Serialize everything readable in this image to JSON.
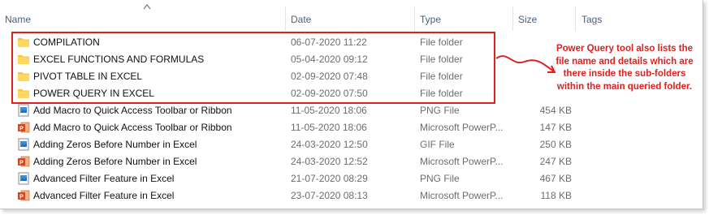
{
  "columns": {
    "name": "Name",
    "date": "Date",
    "type": "Type",
    "size": "Size",
    "tags": "Tags"
  },
  "folders": [
    {
      "name": "COMPILATION",
      "date": "06-07-2020 11:22",
      "type": "File folder",
      "icon": "folder-icon"
    },
    {
      "name": "EXCEL FUNCTIONS AND FORMULAS",
      "date": "05-04-2020 09:12",
      "type": "File folder",
      "icon": "folder-icon"
    },
    {
      "name": "PIVOT TABLE IN EXCEL",
      "date": "02-09-2020 07:48",
      "type": "File folder",
      "icon": "folder-icon"
    },
    {
      "name": "POWER QUERY IN EXCEL",
      "date": "02-09-2020 07:50",
      "type": "File folder",
      "icon": "folder-icon"
    }
  ],
  "files": [
    {
      "name": "Add Macro to Quick Access Toolbar or Ribbon",
      "date": "11-05-2020 18:06",
      "type": "PNG File",
      "size": "454 KB",
      "icon": "image-file-icon"
    },
    {
      "name": "Add Macro to Quick Access Toolbar or Ribbon",
      "date": "11-05-2020 18:06",
      "type": "Microsoft PowerP...",
      "size": "147 KB",
      "icon": "powerpoint-file-icon"
    },
    {
      "name": "Adding Zeros Before Number in Excel",
      "date": "24-03-2020 12:50",
      "type": "GIF File",
      "size": "250 KB",
      "icon": "image-file-icon"
    },
    {
      "name": "Adding Zeros Before Number in Excel",
      "date": "24-03-2020 12:52",
      "type": "Microsoft PowerP...",
      "size": "247 KB",
      "icon": "powerpoint-file-icon"
    },
    {
      "name": "Advanced Filter Feature in Excel",
      "date": "21-07-2020 08:29",
      "type": "PNG File",
      "size": "467 KB",
      "icon": "image-file-icon"
    },
    {
      "name": "Advanced Filter Feature in Excel",
      "date": "23-07-2020 08:13",
      "type": "Microsoft PowerP...",
      "size": "118 KB",
      "icon": "powerpoint-file-icon"
    }
  ],
  "annotation": {
    "text": "Power Query tool also lists the file name and details which are there inside the sub-folders within the main queried folder.",
    "color": "#e0201d"
  },
  "colors": {
    "folder": "#f5c542",
    "powerpoint": "#d24726",
    "highlight": "#e0201d",
    "header_text": "#4c607a"
  }
}
